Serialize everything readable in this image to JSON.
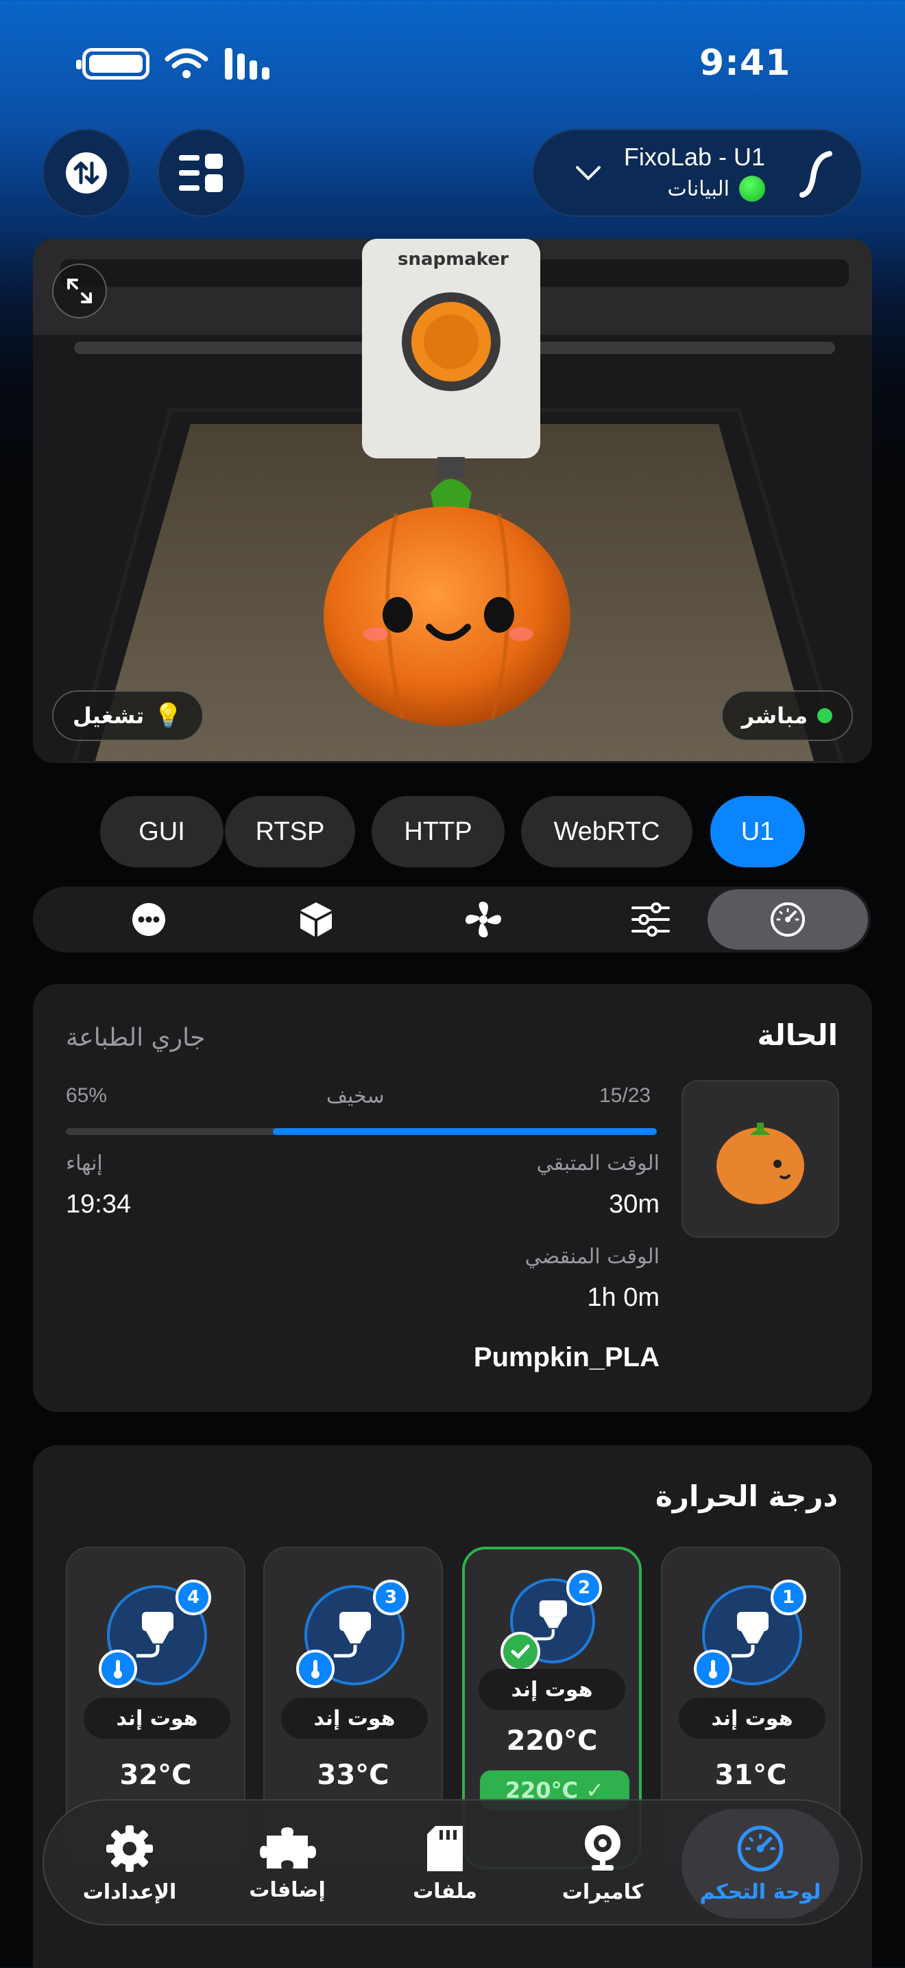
{
  "status_bar": {
    "time": "9:41"
  },
  "printer": {
    "name": "FixoLab - U1",
    "connection_label": "البيانات"
  },
  "camera": {
    "light_label": "تشغيل",
    "live_label": "مباشر",
    "brand": "snapmaker"
  },
  "protocols": [
    "GUI",
    "RTSP",
    "HTTP",
    "WebRTC",
    "U1"
  ],
  "protocol_selected": "U1",
  "tools": [
    "more-icon",
    "cube-icon",
    "fan-icon",
    "sliders-icon",
    "gauge-icon"
  ],
  "status_card": {
    "title": "الحالة",
    "state": "جاري الطباعة",
    "progress_percent_label": "65%",
    "progress": 0.65,
    "quality_label": "سخيف",
    "layers": "15/23",
    "remaining_label": "الوقت المتبقي",
    "remaining_value": "30m",
    "finish_label": "إنهاء",
    "finish_value": "19:34",
    "elapsed_label": "الوقت المنقضي",
    "elapsed_value": "1h 0m",
    "file_name": "Pumpkin_PLA"
  },
  "temperature_card": {
    "title": "درجة الحرارة",
    "extruders": [
      {
        "number": "1",
        "label": "هوت إند",
        "temp": "31°C"
      },
      {
        "number": "2",
        "label": "هوت إند",
        "temp": "220°C",
        "target": "220°C ✓",
        "active": true
      },
      {
        "number": "3",
        "label": "هوت إند",
        "temp": "33°C"
      },
      {
        "number": "4",
        "label": "هوت إند",
        "temp": "32°C"
      }
    ]
  },
  "tab_bar": [
    {
      "label": "لوحة التحكم",
      "icon": "gauge-icon",
      "active": true
    },
    {
      "label": "كاميرات",
      "icon": "webcam-icon"
    },
    {
      "label": "ملفات",
      "icon": "sd-card-icon"
    },
    {
      "label": "إضافات",
      "icon": "puzzle-icon"
    },
    {
      "label": "الإعدادات",
      "icon": "gear-icon"
    }
  ],
  "colors": {
    "accent": "#0a84ff",
    "success": "#2fb14d",
    "card": "#1c1c1e"
  }
}
